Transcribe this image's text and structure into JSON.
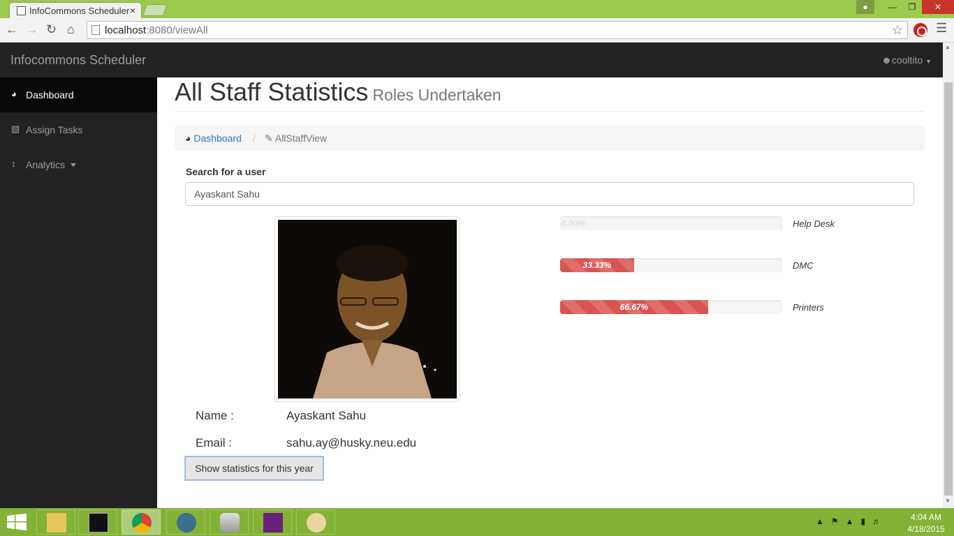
{
  "browser": {
    "tab_title": "InfoCommons Scheduler",
    "url_host": "localhost",
    "url_rest": ":8080/viewAll"
  },
  "navbar": {
    "brand": "Infocommons Scheduler",
    "user": "cooltito"
  },
  "sidebar": {
    "items": [
      {
        "label": "Dashboard",
        "icon": "dashboard-icon",
        "active": true
      },
      {
        "label": "Assign Tasks",
        "icon": "bar-chart-icon",
        "active": false
      },
      {
        "label": "Analytics",
        "icon": "resize-vertical-icon",
        "active": false
      }
    ]
  },
  "page": {
    "title": "All Staff Statistics",
    "subtitle": "Roles Undertaken"
  },
  "breadcrumb": {
    "home": "Dashboard",
    "current": "AllStaffView"
  },
  "search": {
    "label": "Search for a user",
    "value": "Ayaskant Sahu"
  },
  "profile": {
    "name_label": "Name :",
    "name": "Ayaskant Sahu",
    "email_label": "Email :",
    "email": "sahu.ay@husky.neu.edu"
  },
  "stats_button": "Show statistics for this year",
  "roles": [
    {
      "label": "Help Desk",
      "percent_text": "0.00%",
      "percent": 0
    },
    {
      "label": "DMC",
      "percent_text": "33.33%",
      "percent": 33.33
    },
    {
      "label": "Printers",
      "percent_text": "66.67%",
      "percent": 66.67
    }
  ],
  "taskbar": {
    "time": "4:04 AM",
    "date": "4/18/2015"
  },
  "colors": {
    "navbar": "#222222",
    "progress_danger": "#d9534f",
    "link": "#337ab7",
    "taskbar": "#83b236"
  }
}
